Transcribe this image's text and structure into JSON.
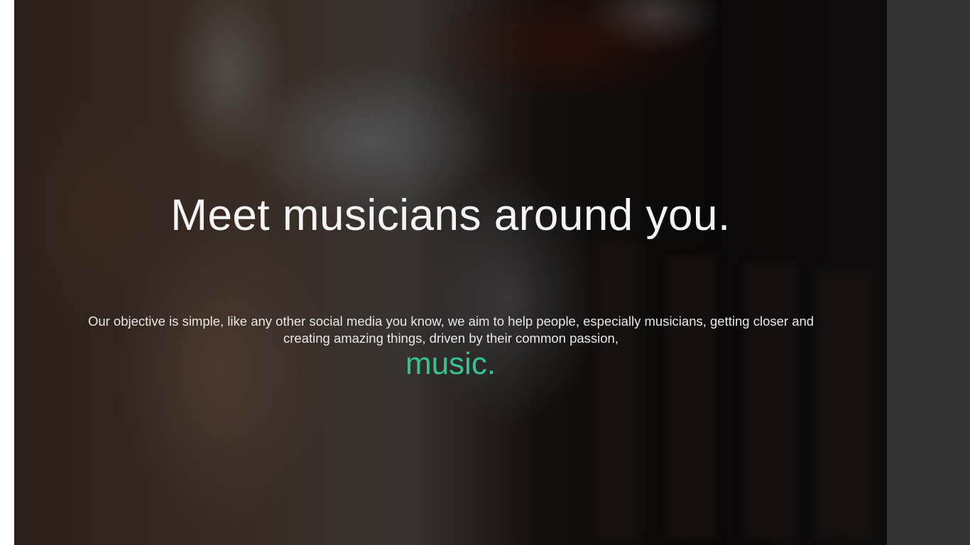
{
  "hero": {
    "headline": "Meet musicians around you.",
    "description": "Our objective is simple, like any other social media you know, we aim to help people, especially musicians, getting closer and creating amazing things, driven by their common passion,",
    "accent_word": "music."
  },
  "colors": {
    "accent": "#36c393",
    "sidebar": "#323232",
    "page_background": "#ffffff"
  }
}
